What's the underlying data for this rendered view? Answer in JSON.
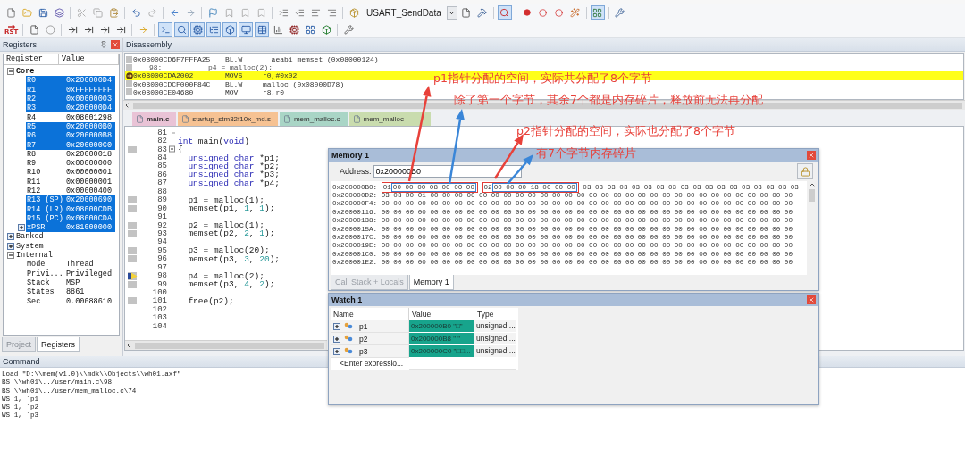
{
  "toolbar": {
    "target": "USART_SendData",
    "reset_label": "RST",
    "debug_on": true,
    "windows_on": true
  },
  "registers": {
    "title": "Registers",
    "columns": [
      "Register",
      "Value"
    ],
    "tree": [
      {
        "name": "Core",
        "bold": true,
        "expanded": true,
        "selected": false,
        "children": [
          {
            "name": "R0",
            "value": "0x200000D4",
            "selected": true
          },
          {
            "name": "R1",
            "value": "0xFFFFFFFF",
            "selected": true
          },
          {
            "name": "R2",
            "value": "0x00000003",
            "selected": true
          },
          {
            "name": "R3",
            "value": "0x200000D4",
            "selected": true
          },
          {
            "name": "R4",
            "value": "0x08001298",
            "selected": false
          },
          {
            "name": "R5",
            "value": "0x200000B0",
            "selected": true
          },
          {
            "name": "R6",
            "value": "0x200000B8",
            "selected": true
          },
          {
            "name": "R7",
            "value": "0x200000C0",
            "selected": true
          },
          {
            "name": "R8",
            "value": "0x20000018",
            "selected": false
          },
          {
            "name": "R9",
            "value": "0x00000000",
            "selected": false
          },
          {
            "name": "R10",
            "value": "0x00000001",
            "selected": false
          },
          {
            "name": "R11",
            "value": "0x00000001",
            "selected": false
          },
          {
            "name": "R12",
            "value": "0x00000400",
            "selected": false
          },
          {
            "name": "R13 (SP)",
            "value": "0x20000690",
            "selected": true
          },
          {
            "name": "R14 (LR)",
            "value": "0x08000CDB",
            "selected": true
          },
          {
            "name": "R15 (PC)",
            "value": "0x08000CDA",
            "selected": true
          },
          {
            "name": "xPSR",
            "value": "0x81000000",
            "selected": true,
            "expanded": false
          }
        ]
      },
      {
        "name": "Banked",
        "bold": false,
        "expanded": false,
        "selected": false
      },
      {
        "name": "System",
        "bold": false,
        "expanded": false,
        "selected": false
      },
      {
        "name": "Internal",
        "bold": false,
        "expanded": true,
        "selected": false,
        "children": [
          {
            "name": "Mode",
            "value": "Thread",
            "selected": false
          },
          {
            "name": "Privi...",
            "value": "Privileged",
            "selected": false
          },
          {
            "name": "Stack",
            "value": "MSP",
            "selected": false
          },
          {
            "name": "States",
            "value": "8861",
            "selected": false
          },
          {
            "name": "Sec",
            "value": "0.00088610",
            "selected": false
          }
        ]
      }
    ]
  },
  "side_tabs": [
    {
      "label": "Project",
      "selected": false
    },
    {
      "label": "Registers",
      "selected": true
    }
  ],
  "disassembly": {
    "title": "Disassembly",
    "lines": [
      {
        "kind": "instruction",
        "current": false,
        "address": "0x08000CD6",
        "opcode": "F7FFFA25",
        "mnemonic": "BL.W",
        "operands": "__aeabi_memset (0x08000124)"
      },
      {
        "kind": "source",
        "current": false,
        "number": "98:",
        "text": "p4 = malloc(2);"
      },
      {
        "kind": "instruction",
        "current": true,
        "address": "0x08000CDA",
        "opcode": "2002",
        "mnemonic": "MOVS",
        "operands": "r0,#0x02"
      },
      {
        "kind": "instruction",
        "current": false,
        "address": "0x08000CDC",
        "opcode": "F000F84C",
        "mnemonic": "BL.W",
        "operands": "malloc (0x08000D78)"
      },
      {
        "kind": "instruction",
        "current": false,
        "address": "0x08000CE0",
        "opcode": "4680",
        "mnemonic": "MOV",
        "operands": "r8,r0"
      }
    ]
  },
  "editor": {
    "tabs": [
      {
        "label": "main.c",
        "selected": true,
        "color": "#e9c3d6"
      },
      {
        "label": "startup_stm32f10x_md.s",
        "selected": false,
        "color": "#f6c293"
      },
      {
        "label": "mem_malloc.c",
        "selected": false,
        "color": "#a9d5c6"
      },
      {
        "label": "mem_malloc",
        "selected": false,
        "color": "#c9dcae"
      }
    ],
    "lines": [
      {
        "number": "81",
        "kind": "fold-end",
        "executable": false,
        "current": false
      },
      {
        "number": "82",
        "kind": "plain",
        "executable": false,
        "current": false,
        "segments": [
          {
            "kind": "keyword",
            "text": "int"
          },
          {
            "kind": "plain",
            "text": " main("
          },
          {
            "kind": "keyword",
            "text": "void"
          },
          {
            "kind": "plain",
            "text": ")"
          }
        ]
      },
      {
        "number": "83",
        "kind": "fold-start",
        "executable": true,
        "current": false,
        "segments": [
          {
            "kind": "plain",
            "text": "{"
          }
        ]
      },
      {
        "number": "84",
        "kind": "plain",
        "executable": false,
        "current": false,
        "segments": [
          {
            "kind": "keyword",
            "text": "  unsigned char"
          },
          {
            "kind": "plain",
            "text": " *p1;"
          }
        ]
      },
      {
        "number": "85",
        "kind": "plain",
        "executable": false,
        "current": false,
        "segments": [
          {
            "kind": "keyword",
            "text": "  unsigned char"
          },
          {
            "kind": "plain",
            "text": " *p2;"
          }
        ]
      },
      {
        "number": "86",
        "kind": "plain",
        "executable": false,
        "current": false,
        "segments": [
          {
            "kind": "keyword",
            "text": "  unsigned char"
          },
          {
            "kind": "plain",
            "text": " *p3;"
          }
        ]
      },
      {
        "number": "87",
        "kind": "plain",
        "executable": false,
        "current": false,
        "segments": [
          {
            "kind": "keyword",
            "text": "  unsigned char"
          },
          {
            "kind": "plain",
            "text": " *p4;"
          }
        ]
      },
      {
        "number": "88",
        "kind": "plain",
        "executable": false,
        "current": false
      },
      {
        "number": "89",
        "kind": "plain",
        "executable": true,
        "current": false,
        "segments": [
          {
            "kind": "plain",
            "text": "  p1 = malloc(1);"
          }
        ]
      },
      {
        "number": "90",
        "kind": "plain",
        "executable": true,
        "current": false,
        "segments": [
          {
            "kind": "plain",
            "text": "  memset(p1, "
          },
          {
            "kind": "number",
            "text": "1"
          },
          {
            "kind": "plain",
            "text": ", "
          },
          {
            "kind": "number",
            "text": "1"
          },
          {
            "kind": "plain",
            "text": ");"
          }
        ]
      },
      {
        "number": "91",
        "kind": "plain",
        "executable": false,
        "current": false
      },
      {
        "number": "92",
        "kind": "plain",
        "executable": true,
        "current": false,
        "segments": [
          {
            "kind": "plain",
            "text": "  p2 = malloc(1);"
          }
        ]
      },
      {
        "number": "93",
        "kind": "plain",
        "executable": true,
        "current": false,
        "segments": [
          {
            "kind": "plain",
            "text": "  memset(p2, "
          },
          {
            "kind": "number",
            "text": "2"
          },
          {
            "kind": "plain",
            "text": ", "
          },
          {
            "kind": "number",
            "text": "1"
          },
          {
            "kind": "plain",
            "text": ");"
          }
        ]
      },
      {
        "number": "94",
        "kind": "plain",
        "executable": false,
        "current": false
      },
      {
        "number": "95",
        "kind": "plain",
        "executable": true,
        "current": false,
        "segments": [
          {
            "kind": "plain",
            "text": "  p3 = malloc(20);"
          }
        ]
      },
      {
        "number": "96",
        "kind": "plain",
        "executable": true,
        "current": false,
        "segments": [
          {
            "kind": "plain",
            "text": "  memset(p3, "
          },
          {
            "kind": "number",
            "text": "3"
          },
          {
            "kind": "plain",
            "text": ", "
          },
          {
            "kind": "number",
            "text": "20"
          },
          {
            "kind": "plain",
            "text": ");"
          }
        ]
      },
      {
        "number": "97",
        "kind": "plain",
        "executable": false,
        "current": false
      },
      {
        "number": "98",
        "kind": "plain",
        "executable": true,
        "current": true,
        "segments": [
          {
            "kind": "plain",
            "text": "  p4 = malloc(2);"
          }
        ]
      },
      {
        "number": "99",
        "kind": "plain",
        "executable": true,
        "current": false,
        "segments": [
          {
            "kind": "plain",
            "text": "  memset(p3, "
          },
          {
            "kind": "number",
            "text": "4"
          },
          {
            "kind": "plain",
            "text": ", "
          },
          {
            "kind": "number",
            "text": "2"
          },
          {
            "kind": "plain",
            "text": ");"
          }
        ]
      },
      {
        "number": "100",
        "kind": "plain",
        "executable": false,
        "current": false
      },
      {
        "number": "101",
        "kind": "plain",
        "executable": true,
        "current": false,
        "segments": [
          {
            "kind": "plain",
            "text": "  free(p2);"
          }
        ]
      },
      {
        "number": "102",
        "kind": "plain",
        "executable": false,
        "current": false
      },
      {
        "number": "103",
        "kind": "plain",
        "executable": false,
        "current": false
      },
      {
        "number": "104",
        "kind": "plain",
        "executable": false,
        "current": false
      }
    ]
  },
  "memory": {
    "title": "Memory 1",
    "address_label": "Address:",
    "address": "0x200000B0",
    "rows": [
      {
        "address": "0x200000B0:",
        "groups": [
          {
            "color": "#e23b36",
            "parts": [
              {
                "bytes": "01"
              },
              {
                "color": "#3a7fd0",
                "parts": [
                  {
                    "bytes": "00 00 00 08 00 00 00"
                  }
                ]
              }
            ]
          },
          {
            "color": "#e23b36",
            "parts": [
              {
                "bytes": "02"
              },
              {
                "color": "#3a7fd0",
                "parts": [
                  {
                    "bytes": "00 00 00 18 00 00 00"
                  }
                ]
              }
            ]
          },
          {
            "bytes": "03 03 03 03 03 03 03 03 03 03 03 03 03 03 03 03 03 03"
          }
        ]
      },
      {
        "address": "0x200000D2:",
        "groups": [
          {
            "bytes": "03 03 D0 01 00 00 00 00 00 00 00 00 00 00 00 00 00 00 00 00 00 00 00 00 00 00 00 00 00 00 00 00 00 00"
          }
        ]
      },
      {
        "address": "0x200000F4:",
        "groups": [
          {
            "bytes": "00 00 00 00 00 00 00 00 00 00 00 00 00 00 00 00 00 00 00 00 00 00 00 00 00 00 00 00 00 00 00 00 00 00"
          }
        ]
      },
      {
        "address": "0x20000116:",
        "groups": [
          {
            "bytes": "00 00 00 00 00 00 00 00 00 00 00 00 00 00 00 00 00 00 00 00 00 00 00 00 00 00 00 00 00 00 00 00 00 00"
          }
        ]
      },
      {
        "address": "0x20000138:",
        "groups": [
          {
            "bytes": "00 00 00 00 00 00 00 00 00 00 00 00 00 00 00 00 00 00 00 00 00 00 00 00 00 00 00 00 00 00 00 00 00 00"
          }
        ]
      },
      {
        "address": "0x2000015A:",
        "groups": [
          {
            "bytes": "00 00 00 00 00 00 00 00 00 00 00 00 00 00 00 00 00 00 00 00 00 00 00 00 00 00 00 00 00 00 00 00 00 00"
          }
        ]
      },
      {
        "address": "0x2000017C:",
        "groups": [
          {
            "bytes": "00 00 00 00 00 00 00 00 00 00 00 00 00 00 00 00 00 00 00 00 00 00 00 00 00 00 00 00 00 00 00 00 00 00"
          }
        ]
      },
      {
        "address": "0x2000019E:",
        "groups": [
          {
            "bytes": "00 00 00 00 00 00 00 00 00 00 00 00 00 00 00 00 00 00 00 00 00 00 00 00 00 00 00 00 00 00 00 00 00 00"
          }
        ]
      },
      {
        "address": "0x200001C0:",
        "groups": [
          {
            "bytes": "00 00 00 00 00 00 00 00 00 00 00 00 00 00 00 00 00 00 00 00 00 00 00 00 00 00 00 00 00 00 00 00 00 00"
          }
        ]
      },
      {
        "address": "0x200001E2:",
        "groups": [
          {
            "bytes": "00 00 00 00 00 00 00 00 00 00 00 00 00 00 00 00 00 00 00 00 00 00 00 00 00 00 00 00 00 00 00 00 00 00"
          }
        ]
      }
    ],
    "tabs": [
      {
        "label": "Call Stack + Locals",
        "selected": false
      },
      {
        "label": "Memory 1",
        "selected": true
      }
    ]
  },
  "watch": {
    "title": "Watch 1",
    "columns": [
      "Name",
      "Value",
      "Type"
    ],
    "rows": [
      {
        "name": "p1",
        "value": "0x200000B0 \"□\"",
        "type": "unsigned ...",
        "expanded": false
      },
      {
        "name": "p2",
        "value": "0x200000B8 \" \"",
        "type": "unsigned ...",
        "expanded": false
      },
      {
        "name": "p3",
        "value": "0x200000C0 \"□□...",
        "type": "unsigned ...",
        "expanded": false
      }
    ],
    "placeholder": "<Enter expressio..."
  },
  "command": {
    "title": "Command",
    "lines": [
      "Load \"D:\\\\mem(v1.0)\\\\mdk\\\\Objects\\\\wh01.axf\"",
      "BS \\\\wh01\\../user/main.c\\98",
      "BS \\\\wh01\\../user/mem_malloc.c\\74",
      "WS 1, `p1",
      "WS 1, `p2",
      "WS 1, `p3"
    ]
  },
  "annotations": [
    "p1指针分配的空间，实际共分配了8个字节",
    "除了第一个字节，其余7个都是内存碎片，释放前无法再分配",
    "p2指针分配的空间，实际也分配了8个字节",
    "有7个字节内存碎片"
  ]
}
